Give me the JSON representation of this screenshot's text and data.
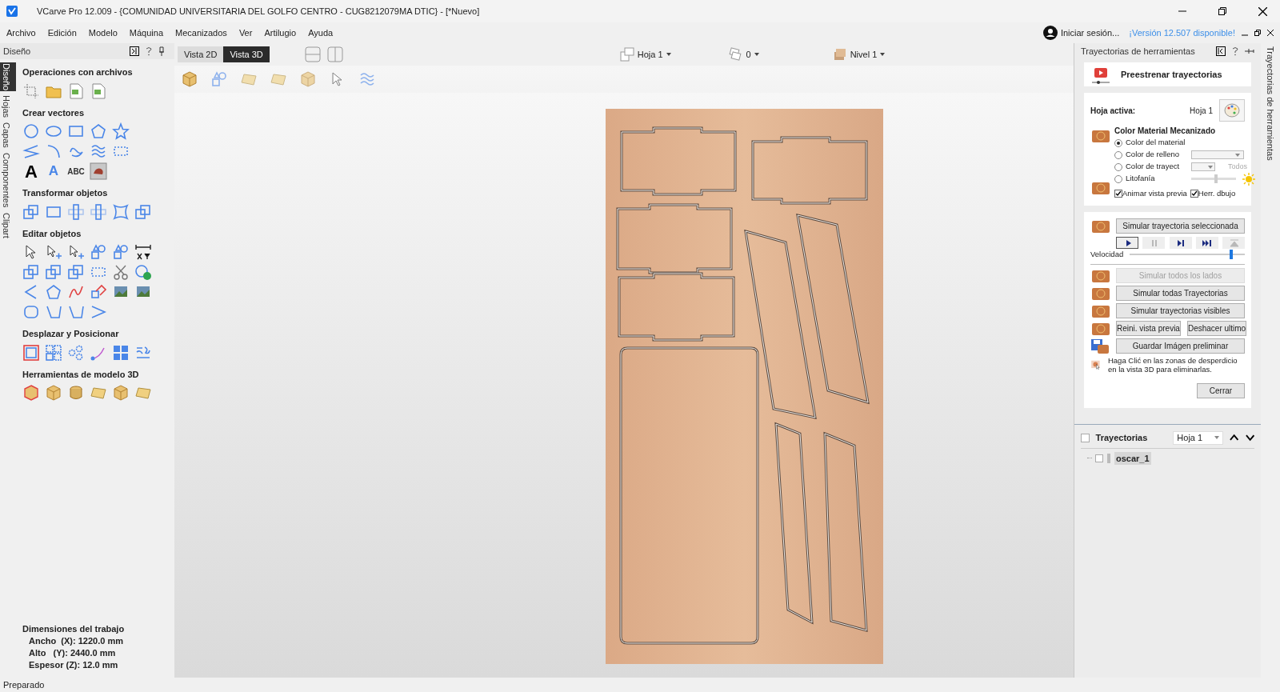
{
  "window": {
    "title": "VCarve Pro 12.009 - {COMUNIDAD UNIVERSITARIA DEL GOLFO CENTRO - CUG8212079MA DTIC} - [*Nuevo]"
  },
  "menu": [
    "Archivo",
    "Edición",
    "Modelo",
    "Máquina",
    "Mecanizados",
    "Ver",
    "Artilugio",
    "Ayuda"
  ],
  "account": {
    "login": "Iniciar sesión...",
    "update": "¡Versión 12.507 disponible!"
  },
  "design_panel": {
    "title": "Diseño",
    "tabs": [
      {
        "label": "Diseño",
        "selected": true
      },
      {
        "label": "Hojas",
        "selected": false
      },
      {
        "label": "Capas",
        "selected": false
      },
      {
        "label": "Componentes",
        "selected": false
      },
      {
        "label": "Clipart",
        "selected": false
      }
    ],
    "sections": [
      {
        "title": "Operaciones con archivos"
      },
      {
        "title": "Crear vectores",
        "text_icons": [
          "A",
          "A",
          "ABC"
        ]
      },
      {
        "title": "Transformar objetos"
      },
      {
        "title": "Editar objetos"
      },
      {
        "title": "Desplazar y Posicionar"
      },
      {
        "title": "Herramientas de modelo 3D"
      }
    ],
    "job": {
      "title": "Dimensiones del trabajo",
      "lines": [
        "Ancho  (X): 1220.0 mm",
        "Alto   (Y): 2440.0 mm",
        "Espesor (Z): 12.0 mm"
      ]
    }
  },
  "view_tabs": [
    {
      "label": "Vista 2D",
      "selected": false
    },
    {
      "label": "Vista 3D",
      "selected": true
    }
  ],
  "view_toolbar": {
    "sheet": "Hoja 1",
    "count": "0",
    "level": "Nivel 1"
  },
  "toolpath_panel": {
    "title": "Trayectorias de herramientas",
    "side_tab": "Trayectorias de herramientas",
    "header": "Preestrenar trayectorias",
    "active_sheet_label": "Hoja activa:",
    "active_sheet": "Hoja 1",
    "color_title": "Color Material Mecanizado",
    "color_options": [
      {
        "label": "Color del material",
        "selected": true,
        "kind": "plain"
      },
      {
        "label": "Color de relleno",
        "selected": false,
        "kind": "dropdown"
      },
      {
        "label": "Color de trayect",
        "selected": false,
        "kind": "dropdown-all"
      },
      {
        "label": "Litofanía",
        "selected": false,
        "kind": "slider"
      }
    ],
    "all_label": "Todos",
    "lithophane": {
      "level": 0.55
    },
    "checks": [
      {
        "label": "Animar vista previa",
        "checked": true
      },
      {
        "label": "Herr. dbujo",
        "checked": true
      }
    ],
    "simulate_selected": "Simular trayectoria seleccionada",
    "playback": [
      {
        "kind": "play",
        "disabled": false
      },
      {
        "kind": "pause",
        "disabled": true
      },
      {
        "kind": "step",
        "disabled": false
      },
      {
        "kind": "end",
        "disabled": false
      },
      {
        "kind": "top",
        "disabled": true
      }
    ],
    "speed_label": "Velocidad",
    "speed": {
      "level": 0.88
    },
    "actions": [
      {
        "label": "Simular todos los lados",
        "disabled": true
      },
      {
        "label": "Simular todas Trayectorias",
        "disabled": false
      },
      {
        "label": "Simular trayectorias visibles",
        "disabled": false
      }
    ],
    "reset": "Reini. vista previa",
    "undo": "Deshacer ultimo",
    "save": "Guardar Imágen preliminar",
    "hint": "Haga Clić en las zonas de desperdicio en la vista 3D para eliminarlas.",
    "close": "Cerrar"
  },
  "toolpaths": {
    "title": "Trayectorias",
    "checked": false,
    "sheet": "Hoja 1",
    "items": [
      {
        "name": "oscar_1",
        "checked": false,
        "selected": true
      }
    ]
  },
  "status_bar": "Preparado"
}
